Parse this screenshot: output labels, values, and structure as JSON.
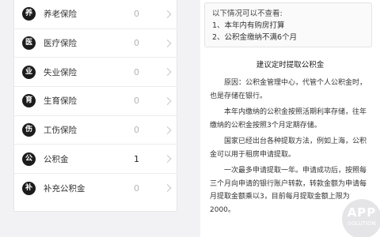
{
  "insurance_list": {
    "items": [
      {
        "badge": "养",
        "label": "养老保险",
        "count": "0"
      },
      {
        "badge": "医",
        "label": "医疗保险",
        "count": "0"
      },
      {
        "badge": "业",
        "label": "失业保险",
        "count": "0"
      },
      {
        "badge": "育",
        "label": "生育保险",
        "count": "0"
      },
      {
        "badge": "伤",
        "label": "工伤保险",
        "count": "0"
      },
      {
        "badge": "公",
        "label": "公积金",
        "count": "1"
      },
      {
        "badge": "补",
        "label": "补充公积金",
        "count": "0"
      }
    ]
  },
  "article": {
    "note_title": "以下情况可以不查看:",
    "note_items": [
      "1、本年内有购房打算",
      "2、公积金缴纳不满6个月"
    ],
    "heading": "建议定时提取公积金",
    "paragraphs": [
      "原因：公积金管理中心，代管个人公积金时，也是存储在银行。",
      "本年内缴纳的公积金按照活期利率存储，往年缴纳的公积金按照3个月定期存储。",
      "国家已经出台各种提取方法，例如上海，公积金可以用于租房申请提取。",
      "一次最多申请提取一年。申请成功后，按照每三个月向申请的银行账户转款，转款金额为申请每月提取金额乘以3，目前每月提取金额上限为2000。"
    ]
  },
  "watermark": {
    "line1": "APP",
    "line2": "SOLUTION"
  }
}
